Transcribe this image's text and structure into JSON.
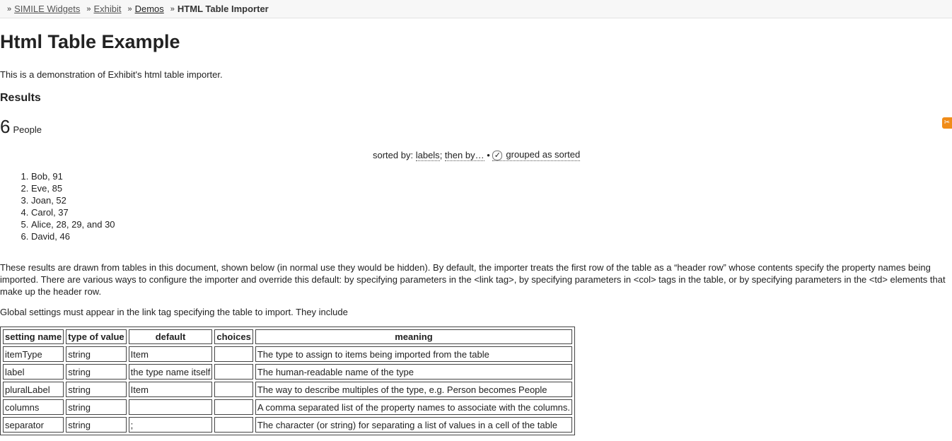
{
  "breadcrumb": {
    "items": [
      "SIMILE Widgets",
      "Exhibit",
      "Demos"
    ],
    "current": "HTML Table Importer",
    "separator": "»"
  },
  "page": {
    "title": "Html Table Example",
    "intro": "This is a demonstration of Exhibit's html table importer.",
    "results_heading": "Results"
  },
  "results": {
    "count": "6",
    "count_label": "People",
    "sort_by_label": "sorted by:",
    "sort_field": "labels",
    "then_by": "then by…",
    "bullet": "•",
    "grouped_label": "grouped as sorted",
    "items": [
      "Bob, 91",
      "Eve, 85",
      "Joan, 52",
      "Carol, 37",
      "Alice, 28, 29, and 30",
      "David, 46"
    ]
  },
  "description": "These results are drawn from tables in this document, shown below (in normal use they would be hidden). By default, the importer treats the first row of the table as a “header row” whose contents specify the property names being imported. There are various ways to configure the importer and override this default: by specifying parameters in the <link tag>, by specifying parameters in <col> tags in the table, or by specifying parameters in the <td> elements that make up the header row.",
  "global_settings_text": "Global settings must appear in the link tag specifying the table to import. They include",
  "settings_table": {
    "headers": [
      "setting name",
      "type of value",
      "default",
      "choices",
      "meaning"
    ],
    "rows": [
      [
        "itemType",
        "string",
        "Item",
        "",
        "The type to assign to items being imported from the table"
      ],
      [
        "label",
        "string",
        "the type name itself",
        "",
        "The human-readable name of the type"
      ],
      [
        "pluralLabel",
        "string",
        "Item",
        "",
        "The way to describe multiples of the type, e.g. Person becomes People"
      ],
      [
        "columns",
        "string",
        "",
        "",
        "A comma separated list of the property names to associate with the columns."
      ],
      [
        "separator",
        "string",
        ";",
        "",
        "The character (or string) for separating a list of values in a cell of the table"
      ]
    ]
  },
  "icons": {
    "feed": "scissors-feed-icon",
    "checkbox": "checkbox-checked-icon"
  },
  "colors": {
    "feed_icon": "#f08c18",
    "breadcrumb_bg": "#f7f7f7"
  }
}
